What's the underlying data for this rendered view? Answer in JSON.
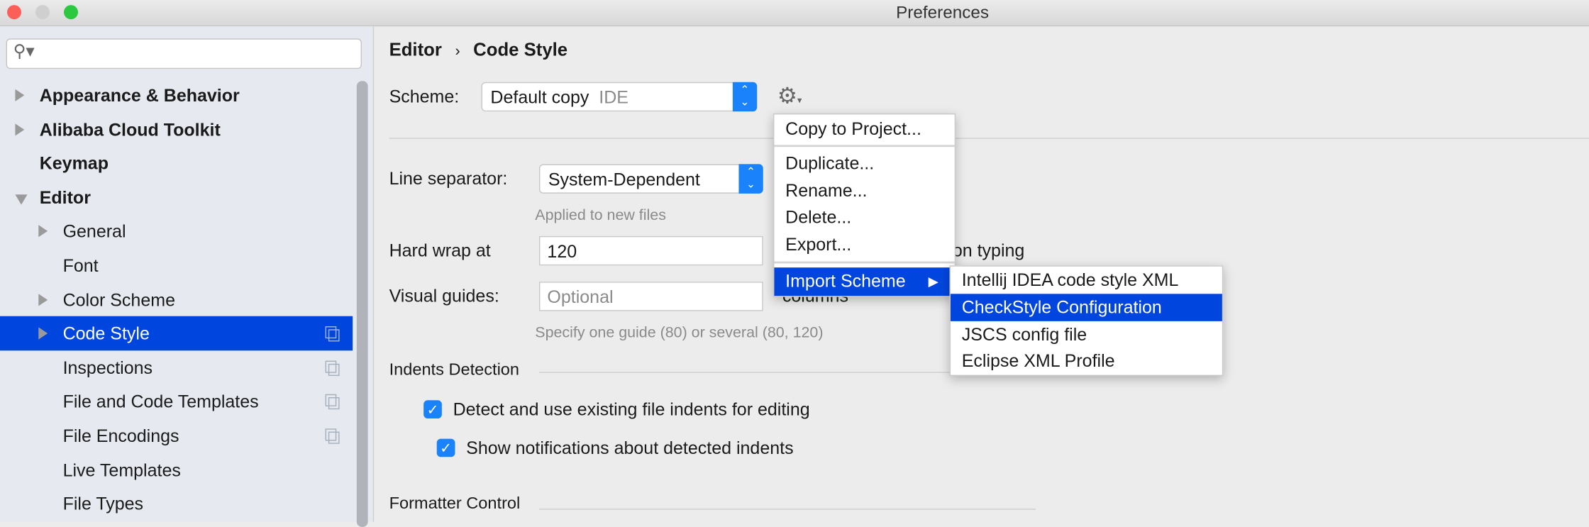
{
  "window": {
    "title": "Preferences",
    "traffic_lights": [
      "#fc5f57",
      "#cfcfcf",
      "#2bc840"
    ]
  },
  "sidebar": {
    "search_placeholder": "",
    "items": [
      {
        "label": "Appearance & Behavior",
        "level": 0,
        "expander": "collapsed",
        "bold": true
      },
      {
        "label": "Alibaba Cloud Toolkit",
        "level": 0,
        "expander": "collapsed",
        "bold": true
      },
      {
        "label": "Keymap",
        "level": 0,
        "expander": "none",
        "bold": true
      },
      {
        "label": "Editor",
        "level": 0,
        "expander": "expanded",
        "bold": true
      },
      {
        "label": "General",
        "level": 1,
        "expander": "collapsed"
      },
      {
        "label": "Font",
        "level": 1,
        "expander": "none"
      },
      {
        "label": "Color Scheme",
        "level": 1,
        "expander": "collapsed"
      },
      {
        "label": "Code Style",
        "level": 1,
        "expander": "collapsed",
        "selected": true,
        "project_icon": true
      },
      {
        "label": "Inspections",
        "level": 1,
        "expander": "none",
        "project_icon": true
      },
      {
        "label": "File and Code Templates",
        "level": 1,
        "expander": "none",
        "project_icon": true
      },
      {
        "label": "File Encodings",
        "level": 1,
        "expander": "none",
        "project_icon": true
      },
      {
        "label": "Live Templates",
        "level": 1,
        "expander": "none"
      },
      {
        "label": "File Types",
        "level": 1,
        "expander": "none"
      }
    ]
  },
  "breadcrumb": {
    "parent": "Editor",
    "separator": "›",
    "current": "Code Style"
  },
  "scheme": {
    "label": "Scheme:",
    "value": "Default copy",
    "tag": "IDE"
  },
  "line_separator": {
    "label": "Line separator:",
    "value": "System-Dependent",
    "hint": "Applied to new files"
  },
  "hard_wrap": {
    "label": "Hard wrap at",
    "value": "120",
    "trailing": "on typing"
  },
  "visual_guides": {
    "label": "Visual guides:",
    "placeholder": "Optional",
    "trailing": "columns",
    "hint": "Specify one guide (80) or several (80, 120)"
  },
  "indents": {
    "title": "Indents Detection",
    "options": [
      {
        "label": "Detect and use existing file indents for editing",
        "checked": true
      },
      {
        "label": "Show notifications about detected indents",
        "checked": true
      }
    ]
  },
  "formatter": {
    "title": "Formatter Control"
  },
  "gear_menu": {
    "items": [
      "Copy to Project...",
      "Duplicate...",
      "Rename...",
      "Delete...",
      "Export...",
      "Import Scheme"
    ]
  },
  "import_submenu": {
    "items": [
      "Intellij IDEA code style XML",
      "CheckStyle Configuration",
      "JSCS config file",
      "Eclipse XML Profile"
    ],
    "highlighted": "CheckStyle Configuration"
  },
  "colors": {
    "selection": "#0046de",
    "accent": "#1a82fb"
  }
}
